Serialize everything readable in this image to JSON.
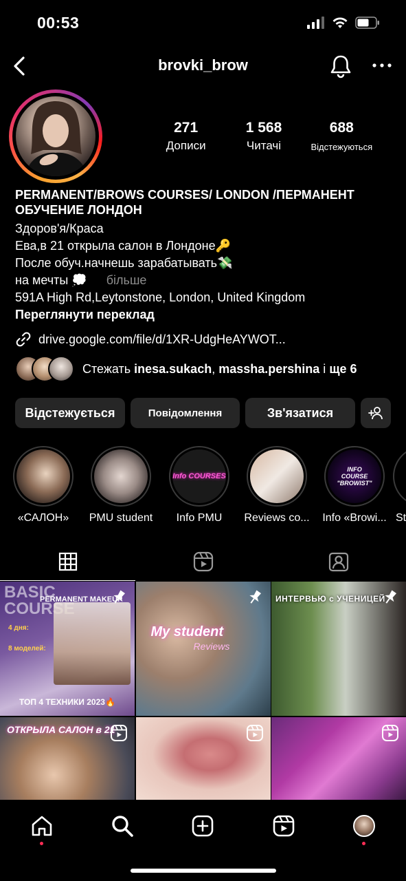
{
  "status_bar": {
    "time": "00:53"
  },
  "nav": {
    "username": "brovki_brow"
  },
  "stats": [
    {
      "value": "271",
      "label": "Дописи"
    },
    {
      "value": "1 568",
      "label": "Читачі"
    },
    {
      "value": "688",
      "label": "Відстежуються"
    }
  ],
  "bio": {
    "name_line1": "PERMANENT/BROWS COURSES/ LONDON /ПЕРМАНЕНТ",
    "name_line2": "ОБУЧЕНИЕ ЛОНДОН",
    "category": "Здоров'я/Краса",
    "line1": "Ева,в 21 открыла салон в Лондоне🔑",
    "line2": "После обуч.начнешь зарабатывать💸",
    "line3": "на мечты 💭",
    "more": "більше",
    "address": "591A High Rd,Leytonstone, London, United Kingdom",
    "translate": "Переглянути переклад",
    "link": "drive.google.com/file/d/1XR-UdgHeAYWOT..."
  },
  "followed_by": {
    "prefix": "Стежать ",
    "user1": "inesa.sukach",
    "separator": ", ",
    "user2": "massha.pershina",
    "suffix_connector": " і ",
    "suffix": "ще 6"
  },
  "buttons": {
    "following": "Відстежується",
    "message": "Повідомлення",
    "contact": "Зв'язатися"
  },
  "highlights": [
    {
      "label": "«САЛОН»",
      "cover_text": ""
    },
    {
      "label": "PMU student",
      "cover_text": ""
    },
    {
      "label": "Info PMU",
      "cover_text": "Info COURSES"
    },
    {
      "label": "Reviews co...",
      "cover_text": ""
    },
    {
      "label": "Info «Browi...",
      "cover_text": "INFO COURSE \"BROWIST\""
    },
    {
      "label": "St",
      "cover_text": ""
    }
  ],
  "grid": {
    "tile1": {
      "title": "BASIC COURSE",
      "sub": "PERMANENT MAKEUP",
      "days": "4 дня:",
      "models": "8 моделей:",
      "promo": "ТОП 4 ТЕХНИКИ 2023🔥"
    },
    "tile2": {
      "title": "My student",
      "sub": "Reviews"
    },
    "tile3": {
      "title": "ИНТЕРВЬЮ с УЧЕНИЦЕЙ"
    },
    "tile4": {
      "title": "ОТКРЫЛА САЛОН в 21"
    },
    "tile5": {
      "title": ""
    },
    "tile6": {
      "title": ""
    }
  },
  "colors": {
    "background": "#000000",
    "button_bg": "#262626",
    "muted": "#8e8e8e",
    "notify_dot": "#ff2d55"
  }
}
